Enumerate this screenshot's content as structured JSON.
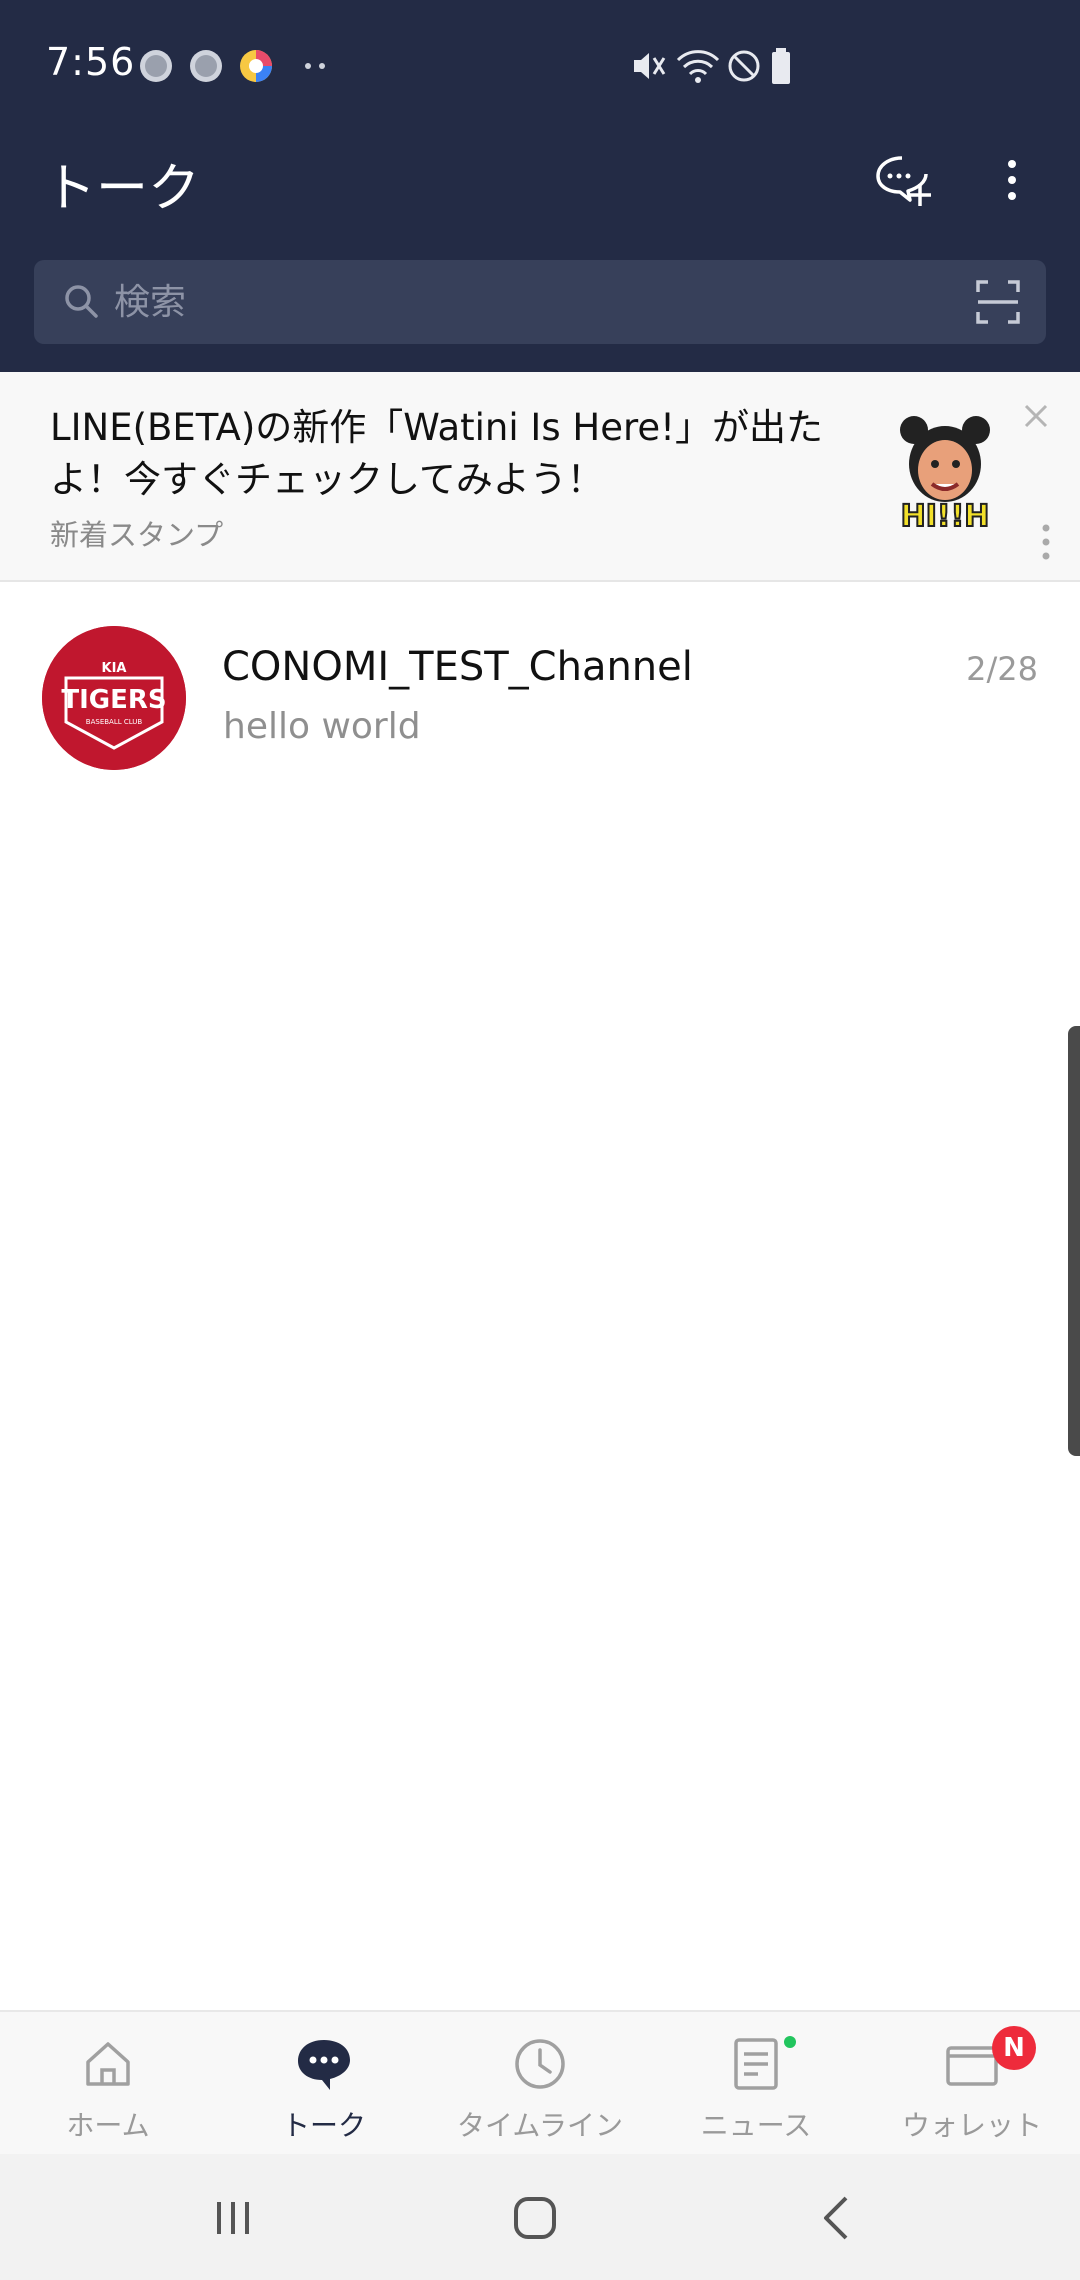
{
  "status_bar": {
    "time": "7:56",
    "notification_icons": [
      "circle-icon",
      "circle-icon",
      "browser-icon",
      "more-dots-icon"
    ],
    "indicators": [
      "mute-icon",
      "wifi-icon",
      "do-not-disturb-icon",
      "battery-icon"
    ]
  },
  "header": {
    "title": "トーク",
    "actions": [
      "new-chat-icon",
      "more-vertical-icon"
    ]
  },
  "search": {
    "placeholder": "検索"
  },
  "promo": {
    "text": "LINE(BETA)の新作「Watini Is Here!」が出たよ！今すぐチェックしてみよう！",
    "subtext": "新着スタンプ",
    "sticker_caption": "HI!!H"
  },
  "chats": [
    {
      "name": "CONOMI_TEST_Channel",
      "last_message": "hello world",
      "date": "2/28",
      "avatar": {
        "brand_top": "KIA",
        "brand": "TIGERS",
        "brand_sub": "BASEBALL CLUB",
        "color": "#c0172e"
      }
    }
  ],
  "bottom_nav": [
    {
      "label": "ホーム",
      "icon": "home-icon",
      "active": false
    },
    {
      "label": "トーク",
      "icon": "talk-icon",
      "active": true
    },
    {
      "label": "タイムライン",
      "icon": "clock-icon",
      "active": false
    },
    {
      "label": "ニュース",
      "icon": "news-icon",
      "active": false,
      "dot": true
    },
    {
      "label": "ウォレット",
      "icon": "wallet-icon",
      "active": false,
      "badge": "N"
    }
  ],
  "colors": {
    "header_bg": "#232b45",
    "search_bg": "#37405a",
    "badge_red": "#ee2b3b",
    "dot_green": "#22c55e",
    "avatar_red": "#c0172e"
  }
}
